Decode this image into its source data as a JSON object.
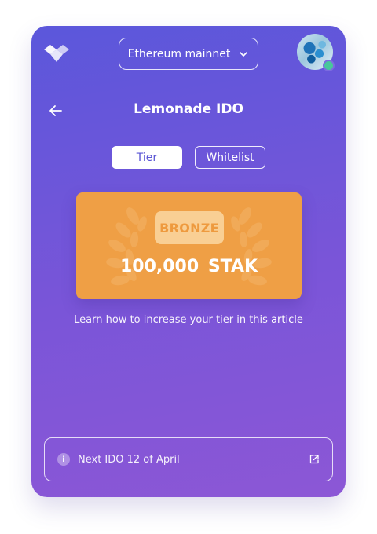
{
  "header": {
    "network": "Ethereum mainnet"
  },
  "page": {
    "title": "Lemonade IDO"
  },
  "tabs": [
    {
      "label": "Tier",
      "active": true
    },
    {
      "label": "Whitelist",
      "active": false
    }
  ],
  "tier": {
    "name": "BRONZE",
    "amount": "100,000",
    "token": "STAK"
  },
  "learn": {
    "text": "Learn how to increase your tier in this ",
    "link": "article"
  },
  "info": {
    "text": "Next IDO 12 of April"
  },
  "colors": {
    "gradient_start": "#5b57db",
    "gradient_end": "#8c57d6",
    "tier_card": "#ef9f45",
    "tier_badge_bg": "#f9cf94",
    "status_online": "#48c79a"
  },
  "icons": {
    "logo": "logo-icon",
    "network_chevron": "chevron-down-icon",
    "back": "arrow-left-icon",
    "info": "info-icon",
    "external": "external-link-icon"
  }
}
